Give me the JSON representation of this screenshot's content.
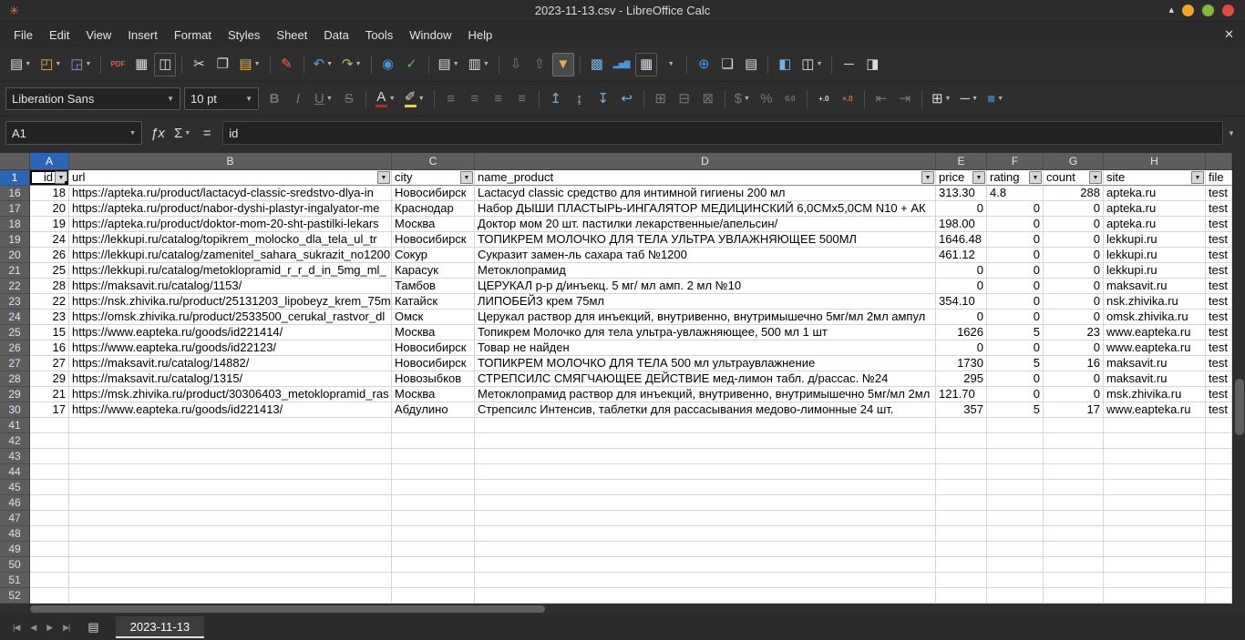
{
  "colors": {
    "selected_header": "#2a66b8",
    "autofilter_highlight": "#e0b14f",
    "grid_line": "#d6d6d6",
    "chrome_background": "#2e2e2e"
  },
  "window": {
    "title": "2023-11-13.csv - LibreOffice Calc",
    "app_icon_glyph": "✳",
    "controls": [
      {
        "name": "shade-button",
        "glyph": "▴"
      },
      {
        "name": "minimize-button",
        "color": "#f5a623"
      },
      {
        "name": "maximize-button",
        "color": "#84b838"
      },
      {
        "name": "close-button",
        "color": "#e04a3f"
      }
    ]
  },
  "menubar": {
    "items": [
      "File",
      "Edit",
      "View",
      "Insert",
      "Format",
      "Styles",
      "Sheet",
      "Data",
      "Tools",
      "Window",
      "Help"
    ],
    "close_document_glyph": "✕"
  },
  "toolbar_main": {
    "items": [
      {
        "name": "new-document-icon",
        "glyph": "▤",
        "color": "#d8dde2",
        "dd": true
      },
      {
        "name": "open-icon",
        "glyph": "◰",
        "color": "#e0b14f",
        "dd": true
      },
      {
        "name": "save-icon",
        "glyph": "◲",
        "color": "#a489dd",
        "dd": true
      },
      {
        "sep": true
      },
      {
        "name": "export-pdf-icon",
        "glyph": "PDF",
        "color": "#e05a4e",
        "small": true
      },
      {
        "name": "print-icon",
        "glyph": "▦",
        "color": "#d8dde2"
      },
      {
        "name": "print-preview-icon",
        "glyph": "◫",
        "color": "#d8dde2",
        "boxed": true
      },
      {
        "sep": true
      },
      {
        "name": "cut-icon",
        "glyph": "✂",
        "color": "#d8dde2"
      },
      {
        "name": "copy-icon",
        "glyph": "❐",
        "color": "#d8dde2"
      },
      {
        "name": "paste-icon",
        "glyph": "▤",
        "color": "#d9b05c",
        "dd": true
      },
      {
        "sep": true
      },
      {
        "name": "clone-formatting-icon",
        "glyph": "✎",
        "color": "#e07050"
      },
      {
        "sep": true
      },
      {
        "name": "undo-icon",
        "glyph": "↶",
        "color": "#5a9fe0",
        "dd": true
      },
      {
        "name": "redo-icon",
        "glyph": "↷",
        "color": "#9dc45e",
        "dd": true
      },
      {
        "sep": true
      },
      {
        "name": "find-and-replace-icon",
        "glyph": "◉",
        "color": "#4a90d9"
      },
      {
        "name": "spelling-icon",
        "glyph": "✓",
        "color": "#58b058"
      },
      {
        "sep": true
      },
      {
        "name": "rows-icon",
        "glyph": "▤",
        "color": "#d8dde2",
        "dd": true
      },
      {
        "name": "columns-icon",
        "glyph": "▥",
        "color": "#d8dde2",
        "dd": true
      },
      {
        "sep": true
      },
      {
        "name": "sort-ascending-icon",
        "glyph": "⇩",
        "disabled": true
      },
      {
        "name": "sort-descending-icon",
        "glyph": "⇧",
        "disabled": true
      },
      {
        "name": "autofilter-icon",
        "glyph": "▼",
        "color": "#e0b14f",
        "pressed": true
      },
      {
        "sep": true
      },
      {
        "name": "insert-image-icon",
        "glyph": "▩",
        "color": "#78b0e0"
      },
      {
        "name": "insert-chart-icon",
        "glyph": "▂▅▇",
        "color": "#4a90d9",
        "small": true
      },
      {
        "name": "insert-pivot-table-icon",
        "glyph": "▦",
        "color": "#d8dde2",
        "boxed": true
      },
      {
        "name": "more-options-dropdown",
        "glyph": "",
        "dd": true
      },
      {
        "sep": true
      },
      {
        "name": "hyperlink-icon",
        "glyph": "⊕",
        "color": "#4a90d9"
      },
      {
        "name": "insert-comment-icon",
        "glyph": "❏",
        "color": "#d8dde2"
      },
      {
        "name": "headers-and-footers-icon",
        "glyph": "▤",
        "color": "#d8dde2"
      },
      {
        "sep": true
      },
      {
        "name": "freeze-rows-and-columns-icon",
        "glyph": "◧",
        "color": "#78b0e0"
      },
      {
        "name": "split-window-icon",
        "glyph": "◫",
        "color": "#d8dde2",
        "dd": true
      },
      {
        "sep": true
      },
      {
        "name": "insert-line-icon",
        "glyph": "─",
        "color": "#d8dde2"
      },
      {
        "name": "sidebar-icon",
        "glyph": "◨",
        "color": "#d8dde2"
      }
    ]
  },
  "toolbar_format": {
    "font_name": "Liberation Sans",
    "font_size": "10 pt",
    "items": [
      {
        "name": "bold-icon",
        "glyph": "B",
        "disabled": true,
        "style": "b"
      },
      {
        "name": "italic-icon",
        "glyph": "I",
        "disabled": true,
        "style": "i"
      },
      {
        "name": "underline-icon",
        "glyph": "U",
        "disabled": true,
        "style": "u",
        "dd": true
      },
      {
        "name": "strikethrough-icon",
        "glyph": "S",
        "disabled": true,
        "style": "s"
      },
      {
        "sep": true
      },
      {
        "name": "font-color-icon",
        "glyph": "A",
        "color": "#d8dde2",
        "bar": "#c9211e",
        "dd": true
      },
      {
        "name": "highlighting-color-icon",
        "glyph": "✐",
        "color": "#d8dde2",
        "bar": "#f7d51a",
        "dd": true
      },
      {
        "sep": true
      },
      {
        "name": "align-left-icon",
        "glyph": "≡",
        "disabled": true
      },
      {
        "name": "align-center-icon",
        "glyph": "≡",
        "disabled": true
      },
      {
        "name": "align-right-icon",
        "glyph": "≡",
        "disabled": true
      },
      {
        "name": "justified-icon",
        "glyph": "≡",
        "disabled": true
      },
      {
        "sep": true
      },
      {
        "name": "align-top-icon",
        "glyph": "↥",
        "color": "#78b0e0"
      },
      {
        "name": "center-vertically-icon",
        "glyph": "↨",
        "color": "#78b0e0"
      },
      {
        "name": "align-bottom-icon",
        "glyph": "↧",
        "color": "#78b0e0"
      },
      {
        "name": "wrap-text-icon",
        "glyph": "↩",
        "color": "#78b0e0"
      },
      {
        "sep": true
      },
      {
        "name": "merge-and-center-cells-icon",
        "glyph": "⊞",
        "disabled": true
      },
      {
        "name": "merge-cells-icon",
        "glyph": "⊟",
        "disabled": true
      },
      {
        "name": "unmerge-cells-icon",
        "glyph": "⊠",
        "disabled": true
      },
      {
        "sep": true
      },
      {
        "name": "format-as-currency-icon",
        "glyph": "$",
        "disabled": true,
        "dd": true
      },
      {
        "name": "format-as-percent-icon",
        "glyph": "%",
        "disabled": true
      },
      {
        "name": "format-as-number-icon",
        "glyph": "0.0",
        "disabled": true,
        "small": true
      },
      {
        "sep": true
      },
      {
        "name": "add-decimal-place-icon",
        "glyph": "+.0",
        "color": "#d8dde2",
        "small": true
      },
      {
        "name": "delete-decimal-place-icon",
        "glyph": "×.0",
        "color": "#d86a5a",
        "small": true
      },
      {
        "sep": true
      },
      {
        "name": "decrease-indent-icon",
        "glyph": "⇤",
        "disabled": true
      },
      {
        "name": "increase-indent-icon",
        "glyph": "⇥",
        "disabled": true
      },
      {
        "sep": true
      },
      {
        "name": "borders-icon",
        "glyph": "⊞",
        "color": "#d8dde2",
        "dd": true
      },
      {
        "name": "border-style-icon",
        "glyph": "─",
        "color": "#d8dde2",
        "dd": true
      },
      {
        "name": "border-color-icon",
        "glyph": "■",
        "color": "#3a6ea5",
        "dd": true
      }
    ]
  },
  "formula_bar": {
    "cell_reference": "A1",
    "formula": "id",
    "icons": [
      {
        "name": "function-wizard-icon",
        "glyph": "ƒx",
        "style": "i"
      },
      {
        "name": "select-function-icon",
        "glyph": "Σ",
        "dd": true
      },
      {
        "name": "formula-icon",
        "glyph": "="
      }
    ],
    "expand_glyph": "▼"
  },
  "grid": {
    "column_letters": [
      "A",
      "B",
      "C",
      "D",
      "E",
      "F",
      "G",
      "H"
    ],
    "selected_column": "A",
    "selected_row": "1",
    "selected_cell": "A1",
    "header_row": {
      "number": "1",
      "cells": [
        "id",
        "url",
        "city",
        "name_product",
        "price",
        "rating",
        "count",
        "site",
        "file"
      ]
    },
    "data_rows": [
      {
        "row": "16",
        "cells": [
          "18",
          "https://apteka.ru/product/lactacyd-classic-sredstvo-dlya-in",
          "Новосибирск",
          "Lactacyd classic средство для интимной гигиены 200 мл",
          "313.30",
          "4.8",
          "288",
          "apteka.ru",
          "test"
        ]
      },
      {
        "row": "17",
        "cells": [
          "20",
          "https://apteka.ru/product/nabor-dyshi-plastyr-ingalyator-me",
          "Краснодар",
          "Набор ДЫШИ ПЛАСТЫРЬ-ИНГАЛЯТОР МЕДИЦИНСКИЙ 6,0СМх5,0СМ N10 + АК",
          "0",
          "0",
          "0",
          "apteka.ru",
          "test"
        ]
      },
      {
        "row": "18",
        "cells": [
          "19",
          "https://apteka.ru/product/doktor-mom-20-sht-pastilki-lekars",
          "Москва",
          "Доктор мом 20 шт. пастилки лекарственные/апельсин/",
          "198.00",
          "0",
          "0",
          "apteka.ru",
          "test"
        ]
      },
      {
        "row": "19",
        "cells": [
          "24",
          "https://lekkupi.ru/catalog/topikrem_molocko_dla_tela_ul_tr",
          "Новосибирск",
          "ТОПИКРЕМ МОЛОЧКО ДЛЯ ТЕЛА УЛЬТРА УВЛАЖНЯЮЩЕЕ 500МЛ",
          "1646.48",
          "0",
          "0",
          "lekkupi.ru",
          "test"
        ]
      },
      {
        "row": "20",
        "cells": [
          "26",
          "https://lekkupi.ru/catalog/zamenitel_sahara_sukrazit_no1200",
          "Сокур",
          "Сукразит замен-ль сахара таб №1200",
          "461.12",
          "0",
          "0",
          "lekkupi.ru",
          "test"
        ]
      },
      {
        "row": "21",
        "cells": [
          "25",
          "https://lekkupi.ru/catalog/metoklopramid_r_r_d_in_5mg_ml_",
          "Карасук",
          "Метоклопрамид",
          "0",
          "0",
          "0",
          "lekkupi.ru",
          "test"
        ]
      },
      {
        "row": "22",
        "cells": [
          "28",
          "https://maksavit.ru/catalog/1153/",
          "Тамбов",
          "ЦЕРУКАЛ р-р д/инъекц. 5 мг/ мл амп. 2 мл №10",
          "0",
          "0",
          "0",
          "maksavit.ru",
          "test"
        ]
      },
      {
        "row": "23",
        "cells": [
          "22",
          "https://nsk.zhivika.ru/product/25131203_lipobeyz_krem_75m",
          "Катайск",
          "ЛИПОБЕЙЗ крем 75мл",
          "354.10",
          "0",
          "0",
          "nsk.zhivika.ru",
          "test"
        ]
      },
      {
        "row": "24",
        "cells": [
          "23",
          "https://omsk.zhivika.ru/product/2533500_cerukal_rastvor_dl",
          "Омск",
          "Церукал раствор для инъекций, внутривенно, внутримышечно 5мг/мл 2мл ампул",
          "0",
          "0",
          "0",
          "omsk.zhivika.ru",
          "test"
        ]
      },
      {
        "row": "25",
        "cells": [
          "15",
          "https://www.eapteka.ru/goods/id221414/",
          "Москва",
          "Топикрем Молочко для тела ультра-увлажняющее, 500 мл 1 шт",
          "1626",
          "5",
          "23",
          "www.eapteka.ru",
          "test"
        ]
      },
      {
        "row": "26",
        "cells": [
          "16",
          "https://www.eapteka.ru/goods/id22123/",
          "Новосибирск",
          "Товар не найден",
          "0",
          "0",
          "0",
          "www.eapteka.ru",
          "test"
        ]
      },
      {
        "row": "27",
        "cells": [
          "27",
          "https://maksavit.ru/catalog/14882/",
          "Новосибирск",
          "ТОПИКРЕМ МОЛОЧКО ДЛЯ ТЕЛА 500 мл ультраувлажнение",
          "1730",
          "5",
          "16",
          "maksavit.ru",
          "test"
        ]
      },
      {
        "row": "28",
        "cells": [
          "29",
          "https://maksavit.ru/catalog/1315/",
          "Новозыбков",
          "СТРЕПСИЛС СМЯГЧАЮЩЕЕ ДЕЙСТВИЕ мед-лимон табл. д/рассас. №24",
          "295",
          "0",
          "0",
          "maksavit.ru",
          "test"
        ]
      },
      {
        "row": "29",
        "cells": [
          "21",
          "https://msk.zhivika.ru/product/30306403_metoklopramid_ras",
          "Москва",
          "Метоклопрамид раствор для инъекций, внутривенно, внутримышечно 5мг/мл 2мл",
          "121.70",
          "0",
          "0",
          "msk.zhivika.ru",
          "test"
        ]
      },
      {
        "row": "30",
        "cells": [
          "17",
          "https://www.eapteka.ru/goods/id221413/",
          "Абдулино",
          "Стрепсилс Интенсив, таблетки для рассасывания медово-лимонные 24 шт.",
          "357",
          "5",
          "17",
          "www.eapteka.ru",
          "test"
        ]
      }
    ],
    "empty_row_numbers": [
      "41",
      "42",
      "43",
      "44",
      "45",
      "46",
      "47",
      "48",
      "49",
      "50",
      "51",
      "52"
    ]
  },
  "tabbar": {
    "sheet_name": "2023-11-13",
    "nav": [
      {
        "name": "first-sheet-button",
        "glyph": "|◀"
      },
      {
        "name": "previous-sheet-button",
        "glyph": "◀"
      },
      {
        "name": "next-sheet-button",
        "glyph": "▶"
      },
      {
        "name": "last-sheet-button",
        "glyph": "▶|"
      }
    ],
    "insert_sheet_glyph": "▤"
  }
}
